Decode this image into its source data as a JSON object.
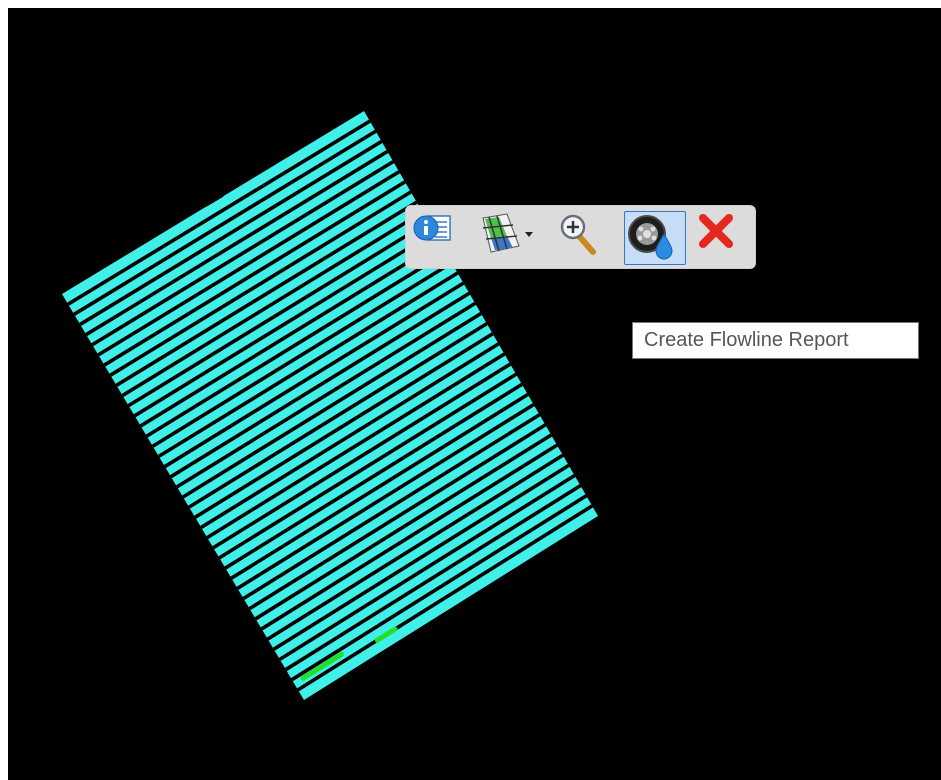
{
  "canvas": {
    "background": "#000000",
    "drawing_color": "#40f0e8",
    "highlight_color": "#22e02a",
    "stripe_count": 40
  },
  "toolbar": {
    "buttons": [
      {
        "icon": "element-info-icon",
        "active": false
      },
      {
        "icon": "grid-surface-icon",
        "has_dropdown": true,
        "active": false
      },
      {
        "icon": "zoom-in-icon",
        "active": false
      },
      {
        "icon": "flowline-report-icon",
        "active": true
      },
      {
        "icon": "close-icon",
        "active": false
      }
    ]
  },
  "tooltip": {
    "text": "Create Flowline Report"
  }
}
